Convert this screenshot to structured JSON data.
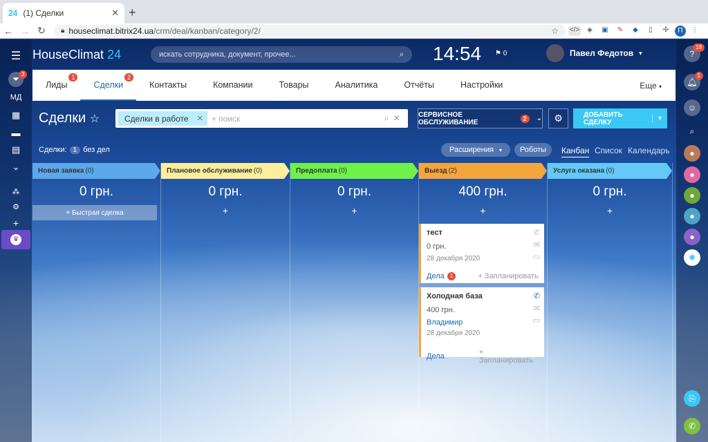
{
  "browser": {
    "tab_favicon": "24",
    "tab_title": "(1) Сделки",
    "url_host": "houseclimat.bitrix24.ua",
    "url_path": "/crm/deal/kanban/category/2/"
  },
  "header": {
    "logo": "HouseClimat",
    "logo_num": "24",
    "search_placeholder": "искать сотрудника, документ, прочее...",
    "clock": "14:54",
    "flag_count": "0",
    "user_name": "Павел Федотов"
  },
  "left_sidebar": {
    "filter_badge": "3",
    "label": "МД"
  },
  "right_sidebar": {
    "help_badge": "18",
    "notify_badge": "1"
  },
  "menu": {
    "items": [
      {
        "label": "Лиды",
        "badge": "1"
      },
      {
        "label": "Сделки",
        "badge": "2"
      },
      {
        "label": "Контакты"
      },
      {
        "label": "Компании"
      },
      {
        "label": "Товары"
      },
      {
        "label": "Аналитика"
      },
      {
        "label": "Отчёты"
      },
      {
        "label": "Настройки"
      }
    ],
    "more": "Еще"
  },
  "page": {
    "title": "Сделки",
    "filter_chip": "Сделки в работе",
    "filter_placeholder": "+ поиск",
    "service_btn": "СЕРВИСНОЕ ОБСЛУЖИВАНИЕ",
    "service_badge": "2",
    "add_btn": "ДОБАВИТЬ СДЕЛКУ",
    "stat_label": "Сделки:",
    "stat_count": "1",
    "stat_suffix": "без дел",
    "extensions": "Расширения",
    "robots": "Роботы",
    "views": [
      "Канбан",
      "Список",
      "Календарь"
    ]
  },
  "columns": [
    {
      "title": "Новая заявка",
      "count": "(0)",
      "sum": "0 грн.",
      "color": "#5ca8ea"
    },
    {
      "title": "Плановое обслуживание",
      "count": "(0)",
      "sum": "0 грн.",
      "color": "#fcee9a"
    },
    {
      "title": "Предоплата",
      "count": "(0)",
      "sum": "0 грн.",
      "color": "#6ef24a"
    },
    {
      "title": "Выезд",
      "count": "(2)",
      "sum": "400 грн.",
      "color": "#f4a53c"
    },
    {
      "title": "Услуга оказана",
      "count": "(0)",
      "sum": "0 грн.",
      "color": "#64c9f7"
    }
  ],
  "quick_deal": "+ Быстрая сделка",
  "cards": [
    {
      "title": "тест",
      "sum": "0 грн.",
      "contact": "",
      "date": "28 декабря 2020",
      "tasks": "Дела",
      "tasks_badge": "1",
      "plan": "+ Запланировать"
    },
    {
      "title": "Холодная база",
      "sum": "400 грн.",
      "contact": "Владимир",
      "date": "28 декабря 2020",
      "tasks": "Дела",
      "tasks_badge": "",
      "plan": "+ Запланировать"
    }
  ]
}
